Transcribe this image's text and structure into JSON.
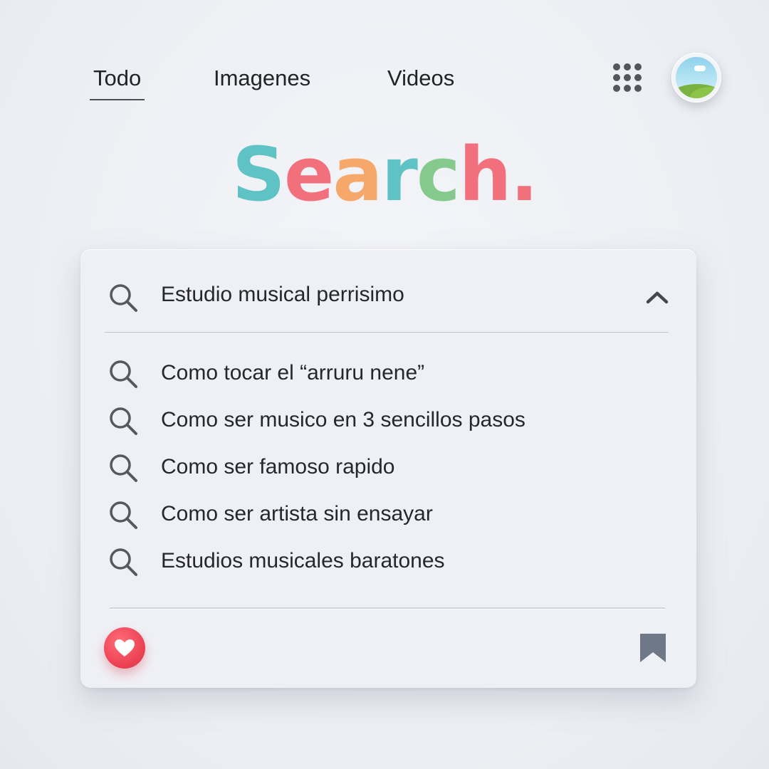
{
  "nav": {
    "tabs": [
      {
        "label": "Todo",
        "active": true
      },
      {
        "label": "Imagenes",
        "active": false
      },
      {
        "label": "Videos",
        "active": false
      }
    ],
    "apps_icon": "grid-dots-icon",
    "avatar_icon": "landscape-avatar"
  },
  "logo": {
    "letters": [
      {
        "char": "S",
        "color": "#5fc3c6"
      },
      {
        "char": "e",
        "color": "#f26f7c"
      },
      {
        "char": "a",
        "color": "#f6a86a"
      },
      {
        "char": "r",
        "color": "#5fc3c6"
      },
      {
        "char": "c",
        "color": "#86c98d"
      },
      {
        "char": "h",
        "color": "#f26f7c"
      },
      {
        "char": ".",
        "color": "#f26f7c"
      }
    ]
  },
  "search": {
    "query": "Estudio musical perrisimo",
    "search_icon": "search-icon",
    "collapse_icon": "chevron-up-icon",
    "suggestions": [
      "Como tocar el “arruru nene”",
      "Como ser musico en 3 sencillos pasos",
      "Como ser famoso rapido",
      "Como ser artista sin ensayar",
      "Estudios musicales baratones"
    ]
  },
  "footer": {
    "like_icon": "heart-icon",
    "like_color": "#ee4556",
    "bookmark_icon": "bookmark-icon",
    "bookmark_color": "#6f7887"
  }
}
